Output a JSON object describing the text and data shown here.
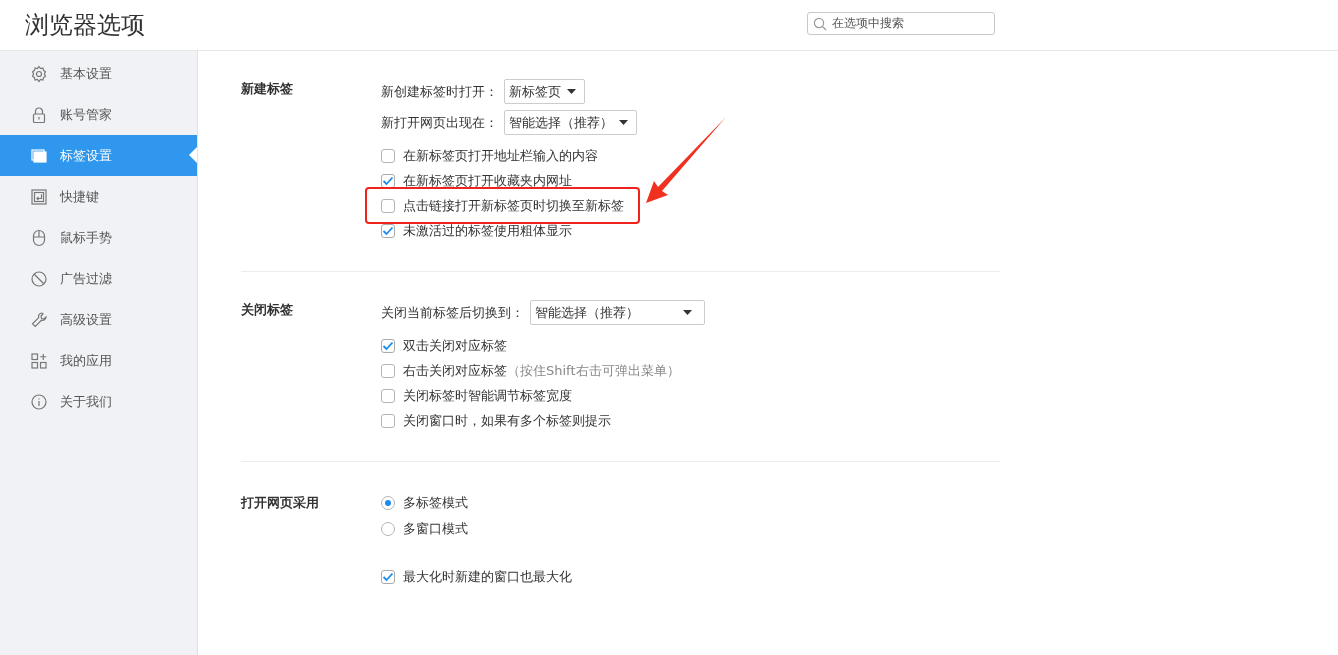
{
  "header": {
    "title": "浏览器选项",
    "search": {
      "placeholder": "在选项中搜索"
    }
  },
  "sidebar": {
    "items": [
      {
        "label": "基本设置",
        "selected": false
      },
      {
        "label": "账号管家",
        "selected": false
      },
      {
        "label": "标签设置",
        "selected": true
      },
      {
        "label": "快捷键",
        "selected": false
      },
      {
        "label": "鼠标手势",
        "selected": false
      },
      {
        "label": "广告过滤",
        "selected": false
      },
      {
        "label": "高级设置",
        "selected": false
      },
      {
        "label": "我的应用",
        "selected": false
      },
      {
        "label": "关于我们",
        "selected": false
      }
    ]
  },
  "sections": [
    {
      "heading": "新建标签",
      "rows": [
        {
          "kind": "dropdown",
          "label": "新创建标签时打开：",
          "value": "新标签页"
        },
        {
          "kind": "dropdown",
          "label": "新打开网页出现在：",
          "value": "智能选择（推荐）"
        },
        {
          "kind": "checkbox",
          "label": "在新标签页打开地址栏输入的内容",
          "checked": false
        },
        {
          "kind": "checkbox",
          "label": "在新标签页打开收藏夹内网址",
          "checked": true
        },
        {
          "kind": "checkbox",
          "label": "点击链接打开新标签页时切换至新标签",
          "checked": false,
          "highlighted": true
        },
        {
          "kind": "checkbox",
          "label": "未激活过的标签使用粗体显示",
          "checked": true
        }
      ]
    },
    {
      "heading": "关闭标签",
      "rows": [
        {
          "kind": "dropdown",
          "label": "关闭当前标签后切换到：",
          "value": "智能选择（推荐）"
        },
        {
          "kind": "checkbox",
          "label": "双击关闭对应标签",
          "checked": true
        },
        {
          "kind": "checkbox",
          "label": "右击关闭对应标签",
          "hint": "（按住Shift右击可弹出菜单）",
          "checked": false
        },
        {
          "kind": "checkbox",
          "label": "关闭标签时智能调节标签宽度",
          "checked": false
        },
        {
          "kind": "checkbox",
          "label": "关闭窗口时，如果有多个标签则提示",
          "checked": false
        }
      ]
    },
    {
      "heading": "打开网页采用",
      "rows": [
        {
          "kind": "radio",
          "label": "多标签模式",
          "selected": true
        },
        {
          "kind": "radio",
          "label": "多窗口模式",
          "selected": false
        },
        {
          "kind": "checkbox",
          "label": "最大化时新建的窗口也最大化",
          "checked": true
        }
      ]
    }
  ]
}
